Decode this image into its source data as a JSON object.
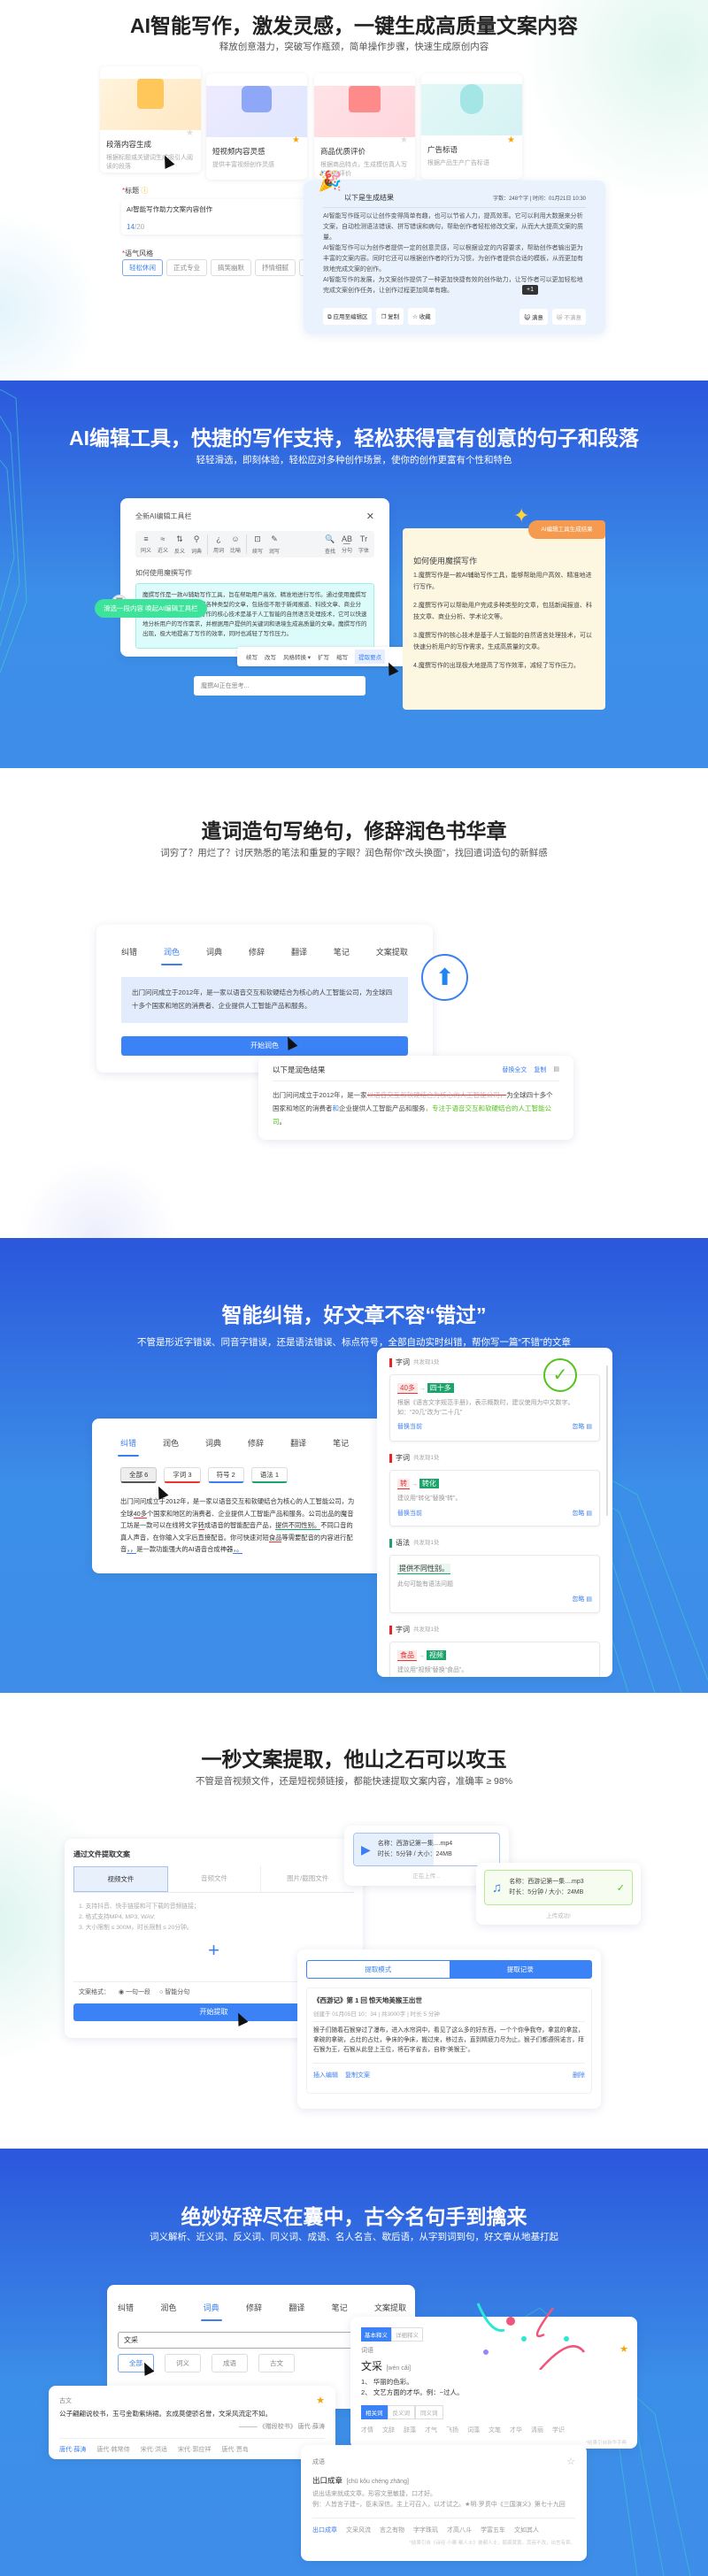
{
  "s1": {
    "title": "AI智能写作，激发灵感，一键生成高质量文案内容",
    "subtitle": "释放创意潜力，突破写作瓶颈，简单操作步骤，快速生成原创内容",
    "cards": [
      {
        "title": "段落内容生成",
        "desc": "根据标题或关键词生成吸引人阅读的段落"
      },
      {
        "title": "短视频内容灵感",
        "desc": "提供丰富视频创作灵感"
      },
      {
        "title": "商品优质评价",
        "desc": "根据商品特点，生成模仿真人写的购物评价"
      },
      {
        "title": "广告标语",
        "desc": "根据产品生产广告标语"
      }
    ],
    "form": {
      "title_label": "标题",
      "title_value": "AI智能写作助力文案内容创作",
      "count_current": "14",
      "count_max": "/20",
      "tone_label": "语气风格",
      "tones": [
        "轻松休闲",
        "正式专业",
        "搞笑幽默",
        "抒情细腻",
        "诙谐"
      ]
    },
    "result": {
      "heading": "以下是生成结果",
      "meta": "字数：248个字 | 时间：01月21日 10:30",
      "paragraphs": [
        "AI智能写作既可以让创作变得简单有趣，也可以节省人力，提高效率。它可以利用大数据来分析文案，自动检测语法错误、拼写错误和病句，帮助创作者轻松修改文案，从而大大提高文案的质量。",
        "AI智能写作可以为创作者提供一定的创意灵感，可以根据设定的内容要求，帮助创作者输出更为丰富的文案内容。同时它还可以根据创作者的行为习惯，为创作者提供合适的模板，从而更加有效地完成文案的创作。",
        "AI智能写作的发展，为文案创作提供了一种更加快捷有效的创作助力，让写作者可以更加轻松地完成文案创作任务，让创作过程更加简单有趣。"
      ],
      "tooltip": "+1",
      "actions": [
        "应用至编辑区",
        "复制",
        "收藏"
      ],
      "like": "满意",
      "dislike": "不满意"
    }
  },
  "s2": {
    "title": "AI编辑工具，快捷的写作支持，轻松获得富有创意的句子和段落",
    "subtitle": "轻轻滑选，即刻体验，轻松应对多种创作场景，使你的创作更富有个性和特色",
    "editor": {
      "title": "全新AI编辑工具栏",
      "tools": [
        {
          "icon": "≡",
          "label": "同义"
        },
        {
          "icon": "≈",
          "label": "近义"
        },
        {
          "icon": "⇅",
          "label": "反义"
        },
        {
          "icon": "⚲",
          "label": "词典"
        },
        {
          "icon": "¿",
          "label": "用词"
        },
        {
          "icon": "☺",
          "label": "比喻"
        },
        {
          "icon": "⊡",
          "label": "续写"
        },
        {
          "icon": "✎",
          "label": "润写"
        },
        {
          "icon": "🔍",
          "label": "查找"
        },
        {
          "icon": "A͟B",
          "label": "分句"
        },
        {
          "icon": "Tr",
          "label": "字体"
        }
      ],
      "doc_title": "如何使用魔撰写作",
      "selected_text": "魔撰写作是一款AI辅助写作工具，旨在帮助用户高效、精准地进行写作。通过使用魔撰写作，用户可以轻松地完成各种类型的文章，包括但不限于新闻报道、科技文章、商业分析、学术论文等。魔撰写作的核心技术是基于人工智能的自然语言处理技术，它可以快速地分析用户的写作需求，并根据用户提供的关键词和语境生成高质量的文章。魔撰写作的出现，极大地提高了写作的效率，同时也减轻了写作压力。",
      "hint": "滑选一段内容 唤起AI编辑工具栏",
      "floating": [
        "续写",
        "改写",
        "风格转换 ▾",
        "扩写",
        "缩写",
        "提取要点"
      ],
      "thinking": "魔撰AI正在思考..."
    },
    "result": {
      "tag": "AI编辑工具生成结果",
      "heading": "如何使用魔撰写作",
      "items": [
        "1.魔撰写作是一款AI辅助写作工具，能够帮助用户高效、精准地进行写作。",
        "2.魔撰写作可以帮助用户完成多种类型的文章，包括新闻报道、科技文章、商业分析、学术论文等。",
        "3.魔撰写作的核心技术是基于人工智能的自然语言处理技术，可以快速分析用户的写作需求，生成高质量的文章。",
        "4.魔撰写作的出现极大地提高了写作效率，减轻了写作压力。"
      ]
    }
  },
  "s3": {
    "title": "遣词造句写绝句，修辞润色书华章",
    "subtitle": "词穷了？用烂了？讨厌熟悉的笔法和重复的字眼？润色帮你“改头换面”，找回遣词造句的新鲜感",
    "tabs": [
      "纠错",
      "润色",
      "词典",
      "修辞",
      "翻译",
      "笔记",
      "文案提取"
    ],
    "input_text": "出门问问成立于2012年，是一家以语音交互和软硬结合为核心的人工智能公司，为全球四十多个国家和地区的消费者、企业提供人工智能产品和服务。",
    "button": "开始润色",
    "result": {
      "heading": "以下是润色结果",
      "actions": [
        "替换全文",
        "复制"
      ],
      "t1": "出门问问成立于2012年，是一家",
      "deleted": "以语音交互和软硬结合为核心的人工智能公司，",
      "t2": "为全球四十多个国家和地区的消费者",
      "ins1": "和",
      "t3": "企业提供人工智能产品和服务",
      "ins2": "，专注于语音交互和软硬结合的人工智能公司",
      "t4": "。"
    }
  },
  "s4": {
    "title": "智能纠错，好文章不容“错过”",
    "subtitle": "不管是形近字错误、同音字错误，还是语法错误、标点符号，全部自动实时纠错，帮你写一篇“不错”的文章",
    "tabs": [
      "纠错",
      "润色",
      "词典",
      "修辞",
      "翻译",
      "笔记"
    ],
    "chips": [
      "全部 6",
      "字词 3",
      "符号 2",
      "语法 1"
    ],
    "text": [
      "出门问问成立于2012年，是一家以语音交互和软硬结合为核心的人工智能公司，为全球",
      "40多",
      "个国家和地区的消费者、企业提供人工智能产品和服务。公司出品的魔音工坊是一款可以在线将文字",
      "转",
      "成语音的智能配音产品，",
      "提供不同性别。",
      "不同口音的真人声音，在你输入文字后直接配音。你可快速对短",
      "食品",
      "等需要配音的内容进行配音",
      "，，",
      "是一款功能强大的AI语音合成神器",
      "，。"
    ],
    "groups": [
      {
        "type": "字词",
        "count": "共发现1处",
        "from": "40多",
        "to": "四十多",
        "note": "根据《语言文字规范手册》，表示概数时，建议使用为中文数字。如：“20几”改为“二十几”",
        "replace": "替换当前",
        "ignore": "忽略"
      },
      {
        "type": "字词",
        "count": "共发现1处",
        "from": "转",
        "to": "转化",
        "note": "建议用“转化”替换“转”。",
        "replace": "替换当前",
        "ignore": "忽略"
      },
      {
        "type": "语法",
        "count": "共发现1处",
        "from": "提供不同性别。",
        "note": "此句可能有语法问题",
        "ignore": "忽略"
      },
      {
        "type": "字词",
        "count": "共发现1处",
        "from": "食品",
        "to": "视频",
        "note": "建议用“视频”替换“食品”。"
      }
    ]
  },
  "s5": {
    "title": "一秒文案提取，他山之石可以攻玉",
    "subtitle": "不管是音视频文件，还是短视频链接，都能快速提取文案内容，准确率 ≥ 98%",
    "panel": {
      "title": "通过文件提取文案",
      "tabs": [
        "视频文件",
        "音频文件",
        "图片/截图文件"
      ],
      "rules": [
        "1. 支持抖音、快手链接和可下载的音频链接；",
        "2. 格式支持MP4, MP3, WAV;",
        "3. 大小限制 ≤ 300M，时长限制 ≤ 20分钟。"
      ],
      "format_label": "文案格式：",
      "options": [
        "一句一段",
        "智能分句"
      ],
      "button": "开始提取"
    },
    "video": {
      "name": "名称：西游记第一集....mp4",
      "meta": "时长：5分钟 / 大小：24MB",
      "status": "正在上传...",
      "progress": 0.55
    },
    "audio": {
      "name": "名称：西游记第一集....mp3",
      "meta": "时长：5分钟 / 大小：24MB",
      "status": "上传成功!"
    },
    "records": {
      "tabs": [
        "提取模式",
        "提取记录"
      ],
      "title": "《西游记》第 1 回  惊天地美猴王出世",
      "meta": "创建于 01月05日 10：34 | 共3000字 | 时长 5 分钟",
      "body": "猴子们随着石猴穿过了瀑布，进入水帘洞中，看见了这么多的好东西，一个个你争我夺，拿盆的拿盆，拿碗的拿碗，占灶的占灶，争床的争床，搬过来，移过去，直到精疲力尽为止。猴子们都遵照诺言，拜石猴为王，石猴从此登上王位，将石字省去，自称“美猴王”。",
      "actions": [
        "插入编辑",
        "复制文案"
      ],
      "delete": "删除"
    }
  },
  "s6": {
    "title": "绝妙好辞尽在囊中，古今名句手到擒来",
    "subtitle": "词义解析、近义词、反义词、同义词、成语、名人名言、歇后语，从字到词到句，好文章从地基打起",
    "tabs": [
      "纠错",
      "润色",
      "词典",
      "修辞",
      "翻译",
      "笔记",
      "文案提取"
    ],
    "query": "文采",
    "filters": [
      "全部",
      "词义",
      "成语",
      "古文"
    ],
    "guwen": {
      "label": "古文",
      "text": "公子翩翩说校书，玉弓金勒紫绡裙。玄成莫便骄名誉，文采风流定不如。",
      "source": "——— 《赠段校书》 唐代·薛涛",
      "authors": [
        "唐代·薛涛",
        "唐代·韩常侍",
        "宋代·洪适",
        "宋代·郭应祥",
        "唐代·贾岛"
      ]
    },
    "def": {
      "tabs": [
        "基本释义",
        "详细释义"
      ],
      "label": "词语",
      "word": "文采",
      "pinyin": "[wén cǎi]",
      "senses": [
        "1、 华丽的色彩。",
        "2、 文艺方面的才华。例：~过人。"
      ],
      "rel_tabs": [
        "相关词",
        "反义词",
        "同义词"
      ],
      "related": [
        "才情",
        "文辞",
        "辞藻",
        "才气",
        "飞扬",
        "词藻",
        "文笔",
        "才华",
        "清丽",
        "学识"
      ],
      "footnote": "*结果引自新华字典"
    },
    "idiom": {
      "label": "成语",
      "word": "出口成章",
      "pinyin": "[chū kǒu chéng zhāng]",
      "meaning": "说出话来就成文章。形容文思敏捷，口才好。",
      "example": "例：人皆言子建~，臣未深信。主上可召入，以才试之。★明·罗贯中《三国演义》第七十九回",
      "related": [
        "出口成章",
        "文采风流",
        "言之有物",
        "字字珠玑",
        "才高八斗",
        "学富五车",
        "文如其人"
      ],
      "footnote": "*结果引自《诗经·小雅·都人士》彼都人士，狐裘黄黄。其容不改，出言有章。"
    }
  },
  "colors": {
    "accent": "#3b7ff0",
    "green": "#1aa36b",
    "error": "#e33333"
  }
}
